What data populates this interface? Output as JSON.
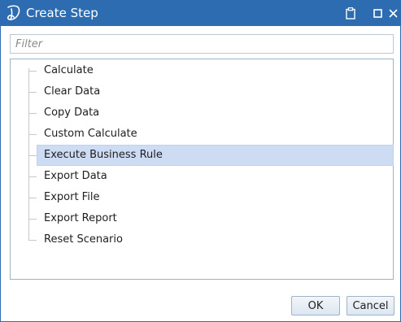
{
  "window": {
    "title": "Create Step"
  },
  "filter": {
    "placeholder": "Filter",
    "value": ""
  },
  "step_types": [
    {
      "label": "Calculate",
      "selected": false
    },
    {
      "label": "Clear Data",
      "selected": false
    },
    {
      "label": "Copy Data",
      "selected": false
    },
    {
      "label": "Custom Calculate",
      "selected": false
    },
    {
      "label": "Execute Business Rule",
      "selected": true
    },
    {
      "label": "Export Data",
      "selected": false
    },
    {
      "label": "Export File",
      "selected": false
    },
    {
      "label": "Export Report",
      "selected": false
    },
    {
      "label": "Reset Scenario",
      "selected": false
    }
  ],
  "buttons": {
    "ok": "OK",
    "cancel": "Cancel"
  },
  "icons": {
    "logo": "app-logo-icon",
    "clipboard": "clipboard-icon",
    "maximize": "maximize-icon",
    "close": "close-icon"
  },
  "colors": {
    "titlebar": "#2d6cb1",
    "selection": "#cddcf3"
  }
}
